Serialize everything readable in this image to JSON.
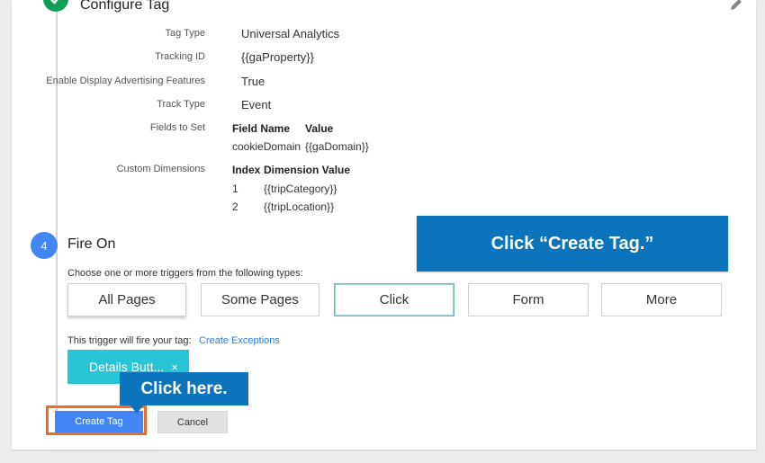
{
  "configure": {
    "title": "Configure Tag",
    "rows": [
      {
        "label": "Tag Type",
        "value": "Universal Analytics"
      },
      {
        "label": "Tracking ID",
        "value": "{{gaProperty}}"
      },
      {
        "label": "Enable Display Advertising Features",
        "value": "True"
      },
      {
        "label": "Track Type",
        "value": "Event"
      }
    ],
    "fields_label": "Fields to Set",
    "fields_headers": [
      "Field Name",
      "Value"
    ],
    "fields_rows": [
      [
        "cookieDomain",
        "{{gaDomain}}"
      ]
    ],
    "dims_label": "Custom Dimensions",
    "dims_headers": [
      "Index",
      "Dimension Value"
    ],
    "dims_rows": [
      [
        "1",
        "{{tripCategory}}"
      ],
      [
        "2",
        "{{tripLocation}}"
      ]
    ]
  },
  "fire": {
    "step": "4",
    "title": "Fire On",
    "instruction": "Choose one or more triggers from the following types:",
    "triggers": [
      "All Pages",
      "Some Pages",
      "Click",
      "Form",
      "More"
    ],
    "fires_text": "This trigger will fire your tag:",
    "exceptions_link": "Create Exceptions",
    "chip_label": "Details Butt...",
    "chip_close": "×"
  },
  "buttons": {
    "create": "Create Tag",
    "cancel": "Cancel"
  },
  "callouts": {
    "create_tag": "Click “Create Tag.”",
    "click_here": "Click here."
  },
  "colors": {
    "accent": "#4285f4",
    "callout": "#0b74bd",
    "chip": "#27c4d6",
    "highlight": "#f26b21",
    "check": "#0f9d58"
  }
}
